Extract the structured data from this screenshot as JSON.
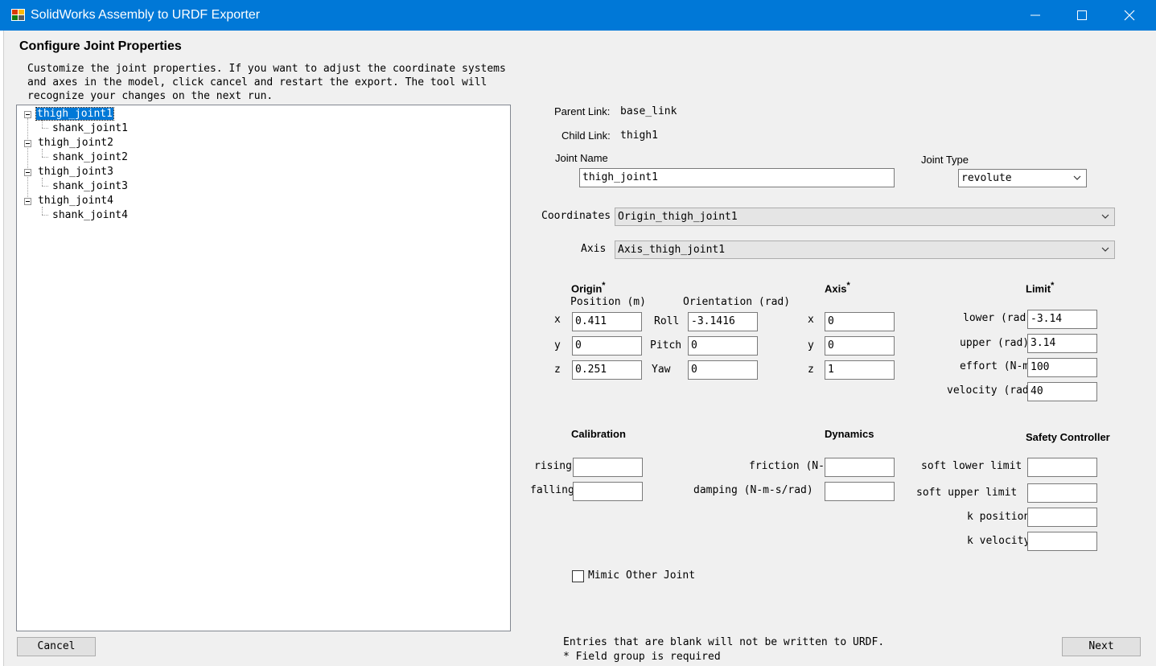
{
  "window": {
    "title": "SolidWorks Assembly to URDF Exporter"
  },
  "page": {
    "heading": "Configure Joint Properties",
    "description": "Customize the joint properties. If you want to adjust the coordinate systems\nand axes in the model, click cancel and restart the export. The tool will\nrecognize your changes on the next run."
  },
  "tree": {
    "nodes": [
      {
        "label": "thigh_joint1",
        "selected": true
      },
      {
        "label": "shank_joint1"
      },
      {
        "label": "thigh_joint2"
      },
      {
        "label": "shank_joint2"
      },
      {
        "label": "thigh_joint3"
      },
      {
        "label": "shank_joint3"
      },
      {
        "label": "thigh_joint4"
      },
      {
        "label": "shank_joint4"
      }
    ]
  },
  "links": {
    "parent_label": "Parent Link:",
    "parent_value": "base_link",
    "child_label": "Child Link:",
    "child_value": "thigh1"
  },
  "joint": {
    "name_label": "Joint Name",
    "name_value": "thigh_joint1",
    "type_label": "Joint Type",
    "type_value": "revolute"
  },
  "coordinates": {
    "label": "Coordinates",
    "value": "Origin_thigh_joint1"
  },
  "axis_select": {
    "label": "Axis",
    "value": "Axis_thigh_joint1"
  },
  "origin": {
    "title": "Origin",
    "required_mark": "*",
    "position_label": "Position (m)",
    "orientation_label": "Orientation (rad)",
    "x_label": "x",
    "y_label": "y",
    "z_label": "z",
    "x": "0.411",
    "y": "0",
    "z": "0.251",
    "roll_label": "Roll",
    "pitch_label": "Pitch",
    "yaw_label": "Yaw",
    "roll": "-3.1416",
    "pitch": "0",
    "yaw": "0"
  },
  "axis": {
    "title": "Axis",
    "required_mark": "*",
    "x_label": "x",
    "y_label": "y",
    "z_label": "z",
    "x": "0",
    "y": "0",
    "z": "1"
  },
  "limit": {
    "title": "Limit",
    "required_mark": "*",
    "lower_label": "lower (rad)",
    "lower": "-3.14",
    "upper_label": "upper (rad)",
    "upper": "3.14",
    "effort_label": "effort (N-m)",
    "effort": "100",
    "velocity_label": "velocity (rad/s)",
    "velocity": "40"
  },
  "calibration": {
    "title": "Calibration",
    "rising_label": "rising",
    "rising": "",
    "falling_label": "falling",
    "falling": ""
  },
  "dynamics": {
    "title": "Dynamics",
    "friction_label": "friction (N-m)",
    "friction": "",
    "damping_label": "damping (N-m-s/rad)",
    "damping": ""
  },
  "safety": {
    "title": "Safety Controller",
    "soft_lower_label": "soft lower limit",
    "soft_lower": "",
    "soft_upper_label": "soft upper limit",
    "soft_upper": "",
    "k_position_label": "k position",
    "k_position": "",
    "k_velocity_label": "k velocity",
    "k_velocity": ""
  },
  "mimic": {
    "label": "Mimic Other Joint",
    "checked": false
  },
  "footer": {
    "note1": "Entries that are blank will not be written to URDF.",
    "note2": "* Field group is required",
    "cancel_label": "Cancel",
    "next_label": "Next"
  },
  "colors": {
    "titlebar": "#0078d7",
    "selection": "#0078d7"
  }
}
